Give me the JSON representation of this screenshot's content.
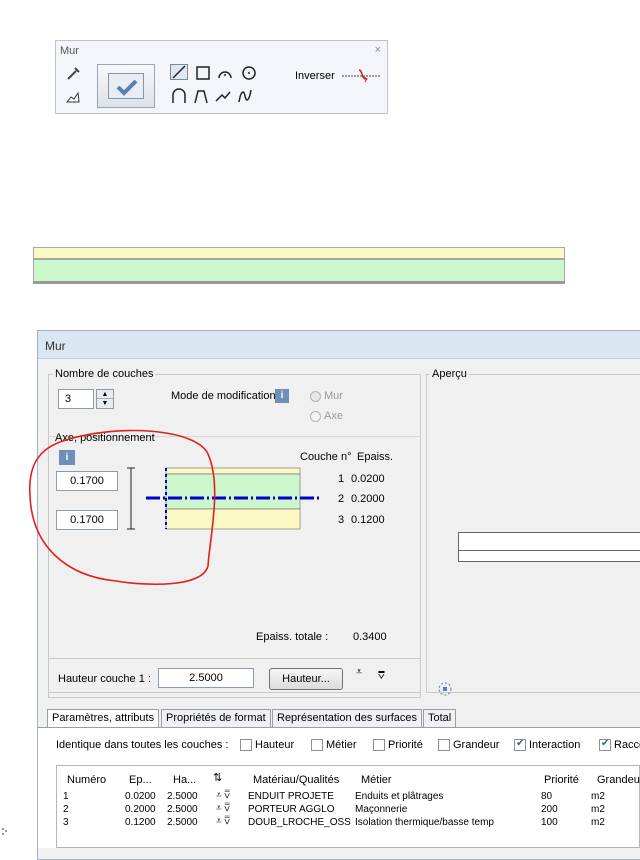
{
  "palette": {
    "title": "Mur",
    "close": "×",
    "invert_label": "Inverser"
  },
  "dialog": {
    "title": "Mur",
    "group_layers": {
      "legend": "Nombre de couches",
      "count": "3",
      "mode_label": "Mode de modification",
      "mode_options": [
        "Mur",
        "Axe"
      ]
    },
    "axis": {
      "legend": "Axe, positionnement",
      "top_value": "0.1700",
      "bottom_value": "0.1700"
    },
    "layers_table": {
      "col_no": "Couche n°",
      "col_thick": "Epaiss.",
      "rows": [
        {
          "no": "1",
          "thick": "0.0200"
        },
        {
          "no": "2",
          "thick": "0.2000"
        },
        {
          "no": "3",
          "thick": "0.1200"
        }
      ]
    },
    "total_label": "Epaiss. totale :",
    "total_value": "0.3400",
    "preview_legend": "Aperçu",
    "height_label": "Hauteur couche 1 :",
    "height_value": "2.5000",
    "height_button": "Hauteur...",
    "tabs": [
      "Paramètres, attributs",
      "Propriétés de format",
      "Représentation des surfaces",
      "Total"
    ],
    "identical_label": "Identique dans toutes les couches :",
    "checkboxes": [
      {
        "label": "Hauteur",
        "checked": false
      },
      {
        "label": "Métier",
        "checked": false
      },
      {
        "label": "Priorité",
        "checked": false
      },
      {
        "label": "Grandeur",
        "checked": false
      },
      {
        "label": "Interaction",
        "checked": true
      },
      {
        "label": "Racco",
        "checked": true
      }
    ],
    "grid": {
      "headers": [
        "Numéro",
        "Ep...",
        "Ha...",
        "Matériau/Qualités",
        "Métier",
        "Priorité",
        "Grandeur"
      ],
      "rows": [
        {
          "num": "1",
          "ep": "0.0200",
          "ha": "2.5000",
          "mat": "ENDUIT PROJETE",
          "metier": "Enduits et plâtrages",
          "prio": "80",
          "grand": "m2"
        },
        {
          "num": "2",
          "ep": "0.2000",
          "ha": "2.5000",
          "mat": "PORTEUR AGGLO",
          "metier": "Maçonnerie",
          "prio": "200",
          "grand": "m2"
        },
        {
          "num": "3",
          "ep": "0.1200",
          "ha": "2.5000",
          "mat": "DOUB_LROCHE_OSS",
          "metier": "Isolation thermique/basse temp",
          "prio": "100",
          "grand": "m2"
        }
      ]
    }
  },
  "colors": {
    "accent_blue": "#0000cc",
    "annotation_red": "#e02020",
    "layer_green": "#ccf6cc",
    "layer_yellow": "#fdf9c4"
  }
}
